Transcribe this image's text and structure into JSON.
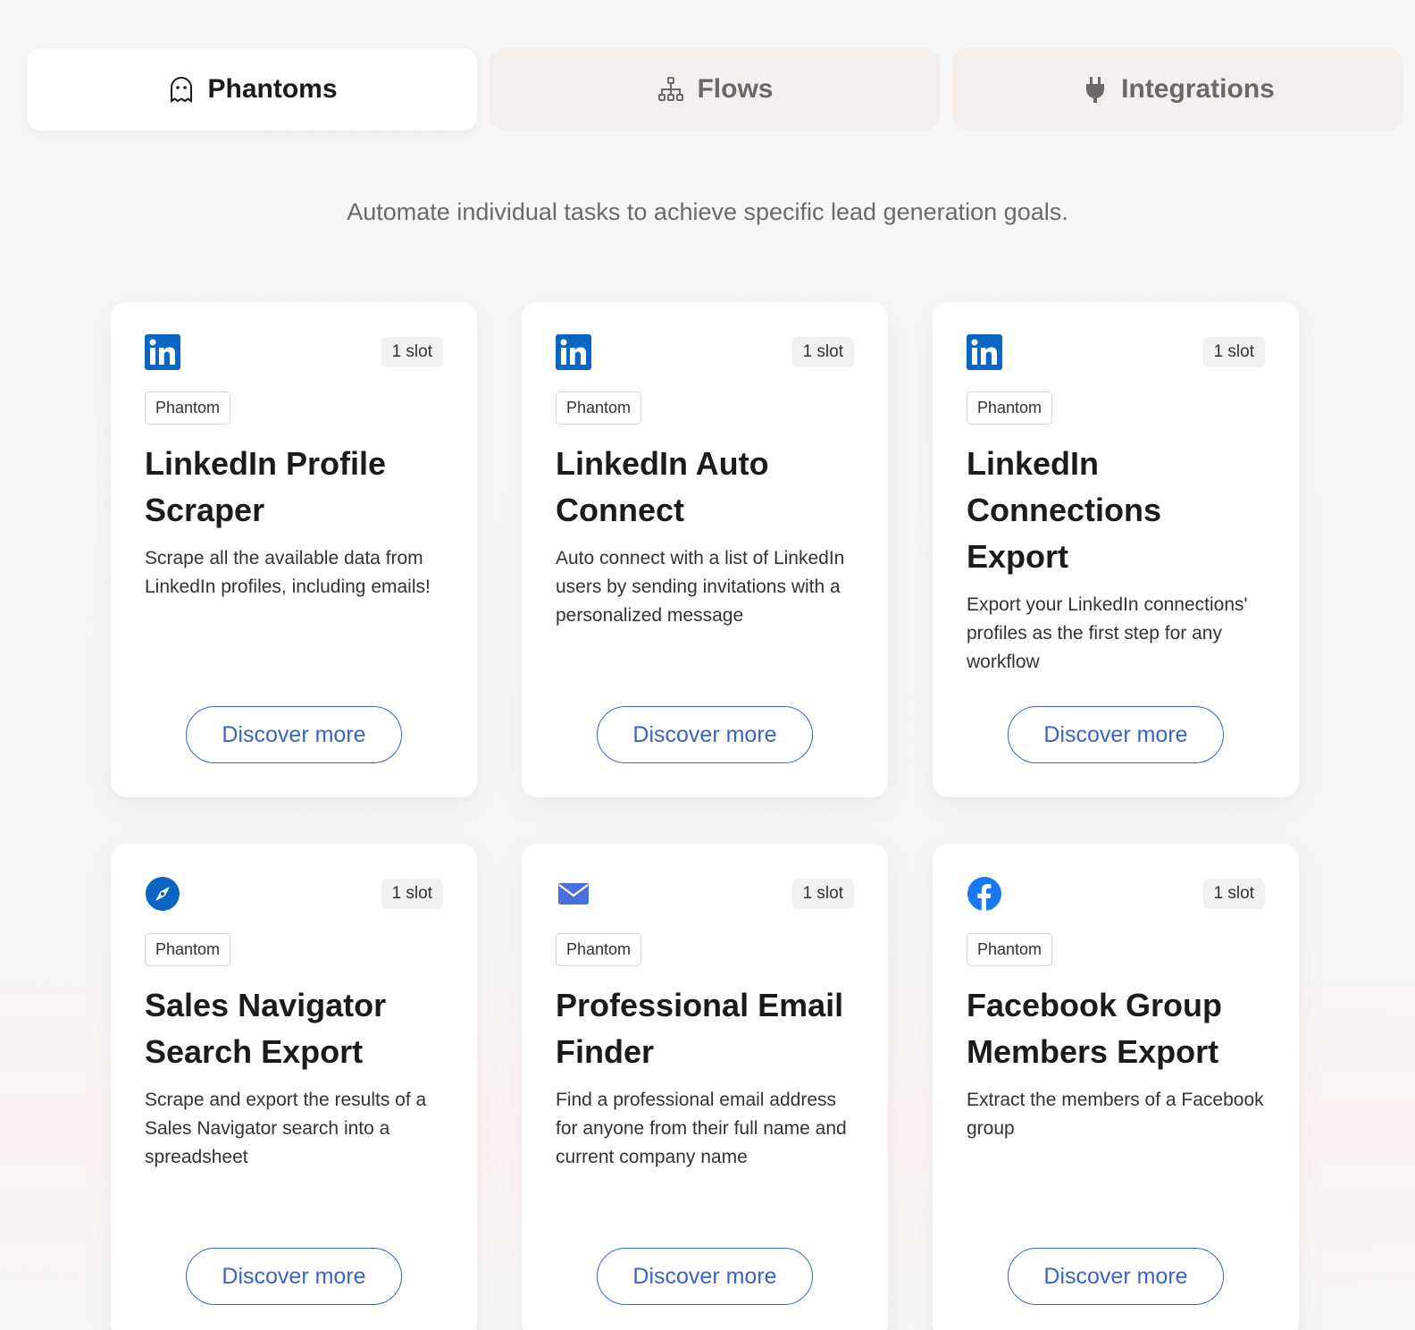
{
  "tabs": [
    {
      "label": "Phantoms",
      "icon": "ghost-icon",
      "active": true
    },
    {
      "label": "Flows",
      "icon": "flow-icon",
      "active": false
    },
    {
      "label": "Integrations",
      "icon": "plug-icon",
      "active": false
    }
  ],
  "subtitle": "Automate individual tasks to achieve specific lead generation goals.",
  "cards": [
    {
      "icon": "linkedin-icon",
      "slot": "1 slot",
      "tag": "Phantom",
      "title": "LinkedIn Profile Scraper",
      "description": "Scrape all the available data from LinkedIn profiles, including emails!",
      "button": "Discover more"
    },
    {
      "icon": "linkedin-icon",
      "slot": "1 slot",
      "tag": "Phantom",
      "title": "LinkedIn Auto Connect",
      "description": "Auto connect with a list of LinkedIn users by sending invitations with a personalized message",
      "button": "Discover more"
    },
    {
      "icon": "linkedin-icon",
      "slot": "1 slot",
      "tag": "Phantom",
      "title": "LinkedIn Connections Export",
      "description": "Export your LinkedIn connections' profiles as the first step for any workflow",
      "button": "Discover more"
    },
    {
      "icon": "compass-icon",
      "slot": "1 slot",
      "tag": "Phantom",
      "title": "Sales Navigator Search Export",
      "description": "Scrape and export the results of a Sales Navigator search into a spreadsheet",
      "button": "Discover more"
    },
    {
      "icon": "mail-icon",
      "slot": "1 slot",
      "tag": "Phantom",
      "title": "Professional Email Finder",
      "description": "Find a professional email address for anyone from their full name and current company name",
      "button": "Discover more"
    },
    {
      "icon": "facebook-icon",
      "slot": "1 slot",
      "tag": "Phantom",
      "title": "Facebook Group Members Export",
      "description": "Extract the members of a Facebook group",
      "button": "Discover more"
    }
  ],
  "colors": {
    "linkedin": "#0a66c2",
    "link": "#3a63c7",
    "facebook": "#1877f2",
    "mail": "#4a6fe0"
  }
}
